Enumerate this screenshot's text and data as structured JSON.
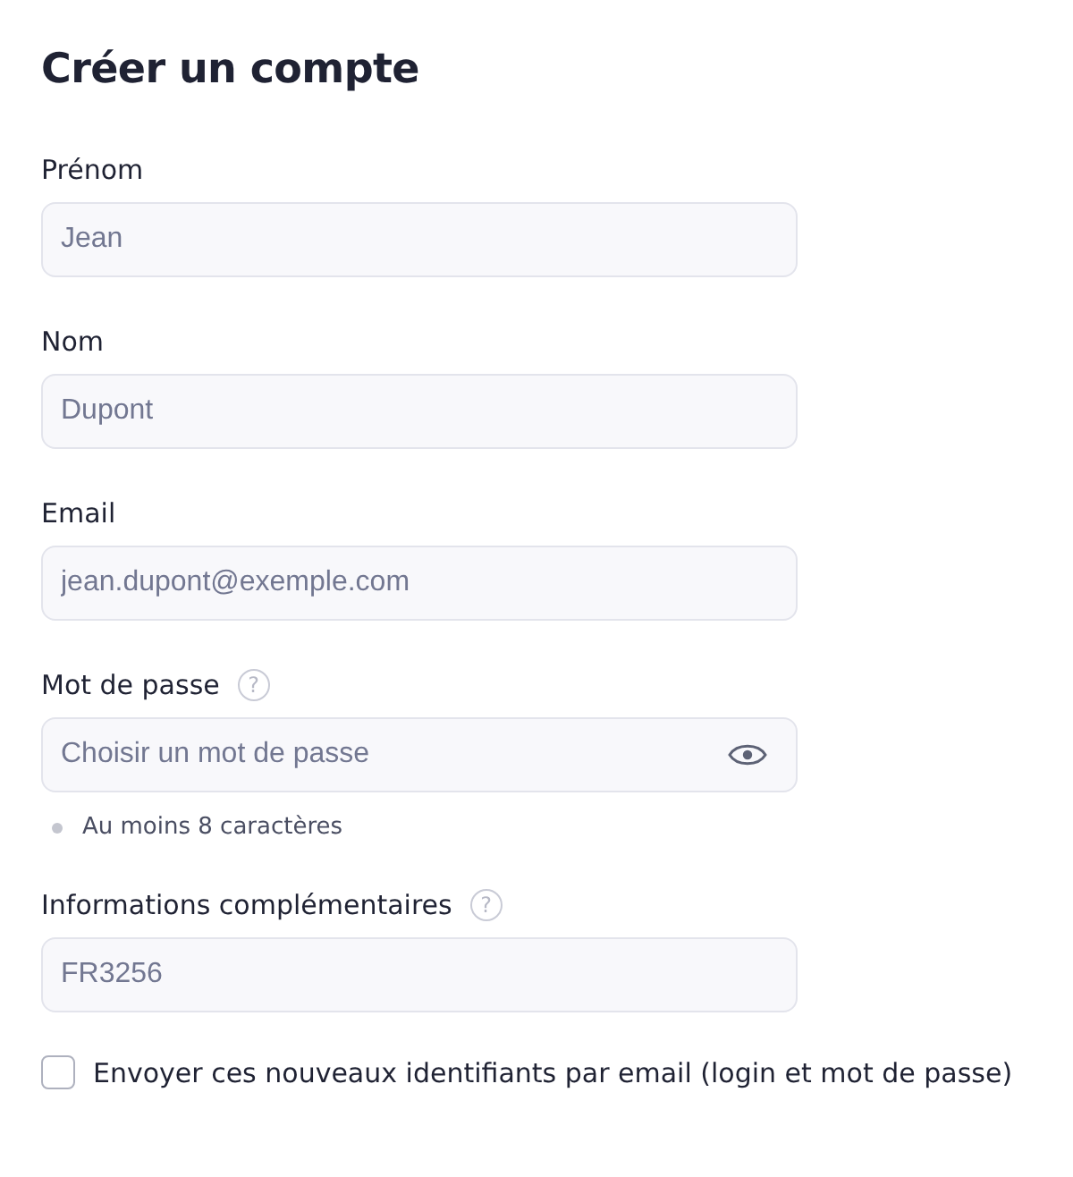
{
  "title": "Créer un compte",
  "fields": [
    {
      "kind": "text",
      "label": "Prénom",
      "placeholder": "Jean"
    },
    {
      "kind": "text",
      "label": "Nom",
      "placeholder": "Dupont"
    },
    {
      "kind": "text",
      "label": "Email",
      "placeholder": "jean.dupont@exemple.com"
    },
    {
      "kind": "password",
      "label": "Mot de passe",
      "help": "?",
      "placeholder": "Choisir un mot de passe",
      "rules": [
        "Au moins 8 caractères"
      ]
    },
    {
      "kind": "text",
      "label": "Informations complémentaires",
      "help": "?",
      "placeholder": "FR3256"
    }
  ],
  "checkbox": {
    "label": "Envoyer ces nouveaux identifiants par email (login et mot de passe)",
    "checked": false
  }
}
